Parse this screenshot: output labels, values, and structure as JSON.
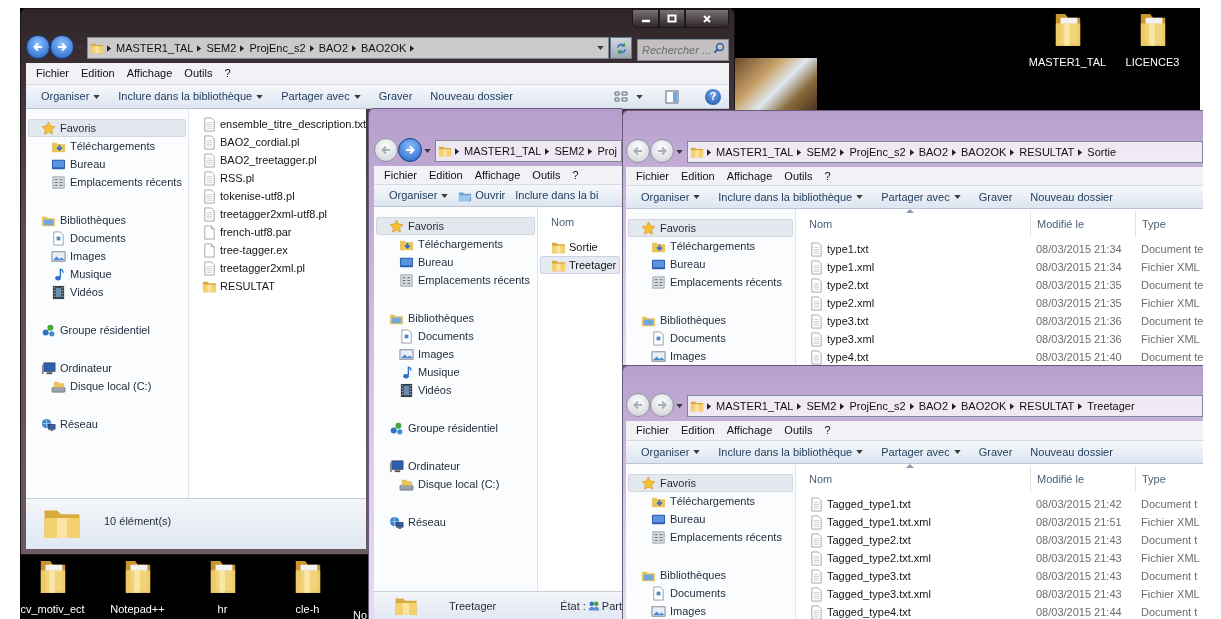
{
  "desktop": {
    "top_icons": [
      {
        "label": "MASTER1_TAL",
        "partial": false
      },
      {
        "label": "LICENCE3",
        "partial": false
      }
    ],
    "bottom_icons": [
      {
        "label": "cv_motiv_ect",
        "partial": false
      },
      {
        "label": "Notepad++",
        "partial": false
      },
      {
        "label": "hr",
        "partial": false
      },
      {
        "label": "cle-h",
        "partial": false
      },
      {
        "label": "No",
        "partial": true
      }
    ]
  },
  "windows": [
    {
      "title_buttons": true,
      "back_enabled": true,
      "forward_enabled": true,
      "address": {
        "crumbs": [
          "MASTER1_TAL",
          "SEM2",
          "ProjEnc_s2",
          "BAO2",
          "BAO2OK"
        ],
        "trailing_arrow": true,
        "refresh_button": true
      },
      "search": {
        "placeholder": "Rechercher ..."
      },
      "menu": [
        "Fichier",
        "Edition",
        "Affichage",
        "Outils",
        "?"
      ],
      "toolbar": [
        {
          "label": "Organiser",
          "kind": "dropdown"
        },
        {
          "label": "Inclure dans la bibliothèque",
          "kind": "dropdown"
        },
        {
          "label": "Partager avec",
          "kind": "dropdown"
        },
        {
          "label": "Graver",
          "kind": "button"
        },
        {
          "label": "Nouveau dossier",
          "kind": "button"
        }
      ],
      "view_buttons": [
        {
          "kind": "views"
        },
        {
          "kind": "preview"
        },
        {
          "kind": "help",
          "label": "?"
        }
      ],
      "sidebar": [
        {
          "label": "Favoris",
          "kind": "star",
          "selected": true,
          "children": [
            {
              "label": "Téléchargements",
              "kind": "download",
              "selected": false
            },
            {
              "label": "Bureau",
              "kind": "desktop",
              "selected": false
            },
            {
              "label": "Emplacements récents",
              "kind": "recent",
              "selected": false
            }
          ]
        },
        {
          "label": "Bibliothèques",
          "kind": "library",
          "selected": false,
          "children": [
            {
              "label": "Documents",
              "kind": "documents",
              "selected": false
            },
            {
              "label": "Images",
              "kind": "images",
              "selected": false
            },
            {
              "label": "Musique",
              "kind": "music",
              "selected": false
            },
            {
              "label": "Vidéos",
              "kind": "videos",
              "selected": false
            }
          ]
        },
        {
          "label": "Groupe résidentiel",
          "kind": "homegroup",
          "selected": false
        },
        {
          "label": "Ordinateur",
          "kind": "computer",
          "selected": false,
          "children": [
            {
              "label": "Disque local (C:)",
              "kind": "disk",
              "selected": false
            }
          ]
        },
        {
          "label": "Réseau",
          "kind": "network",
          "selected": false
        }
      ],
      "files": [
        {
          "name": "ensemble_titre_description.txt",
          "kind": "text",
          "selected": false
        },
        {
          "name": "BAO2_cordial.pl",
          "kind": "text",
          "selected": false
        },
        {
          "name": "BAO2_treetagger.pl",
          "kind": "text",
          "selected": false
        },
        {
          "name": "RSS.pl",
          "kind": "text",
          "selected": false
        },
        {
          "name": "tokenise-utf8.pl",
          "kind": "text",
          "selected": false
        },
        {
          "name": "treetagger2xml-utf8.pl",
          "kind": "text",
          "selected": false
        },
        {
          "name": "french-utf8.par",
          "kind": "blank",
          "selected": false
        },
        {
          "name": "tree-tagger.ex",
          "kind": "blank",
          "selected": false
        },
        {
          "name": "treetagger2xml.pl",
          "kind": "text",
          "selected": false
        },
        {
          "name": "RESULTAT",
          "kind": "folder",
          "selected": false
        }
      ],
      "status": {
        "kind": "count",
        "text": "10 élément(s)"
      }
    },
    {
      "back_enabled": false,
      "forward_enabled": true,
      "address": {
        "crumbs": [
          "MASTER1_TAL",
          "SEM2",
          "Proj"
        ],
        "trailing_arrow": false,
        "refresh_button": false
      },
      "menu": [
        "Fichier",
        "Edition",
        "Affichage",
        "Outils",
        "?"
      ],
      "toolbar": [
        {
          "label": "Organiser",
          "kind": "dropdown"
        },
        {
          "label": "Ouvrir",
          "kind": "open"
        },
        {
          "label": "Inclure dans la bi",
          "kind": "button"
        }
      ],
      "sidebar": [
        {
          "label": "Favoris",
          "kind": "star",
          "selected": true,
          "children": [
            {
              "label": "Téléchargements",
              "kind": "download",
              "selected": false
            },
            {
              "label": "Bureau",
              "kind": "desktop",
              "selected": false
            },
            {
              "label": "Emplacements récents",
              "kind": "recent",
              "selected": false
            }
          ]
        },
        {
          "label": "Bibliothèques",
          "kind": "library",
          "selected": false,
          "children": [
            {
              "label": "Documents",
              "kind": "documents",
              "selected": false
            },
            {
              "label": "Images",
              "kind": "images",
              "selected": false
            },
            {
              "label": "Musique",
              "kind": "music",
              "selected": false
            },
            {
              "label": "Vidéos",
              "kind": "videos",
              "selected": false
            }
          ]
        },
        {
          "label": "Groupe résidentiel",
          "kind": "homegroup",
          "selected": false
        },
        {
          "label": "Ordinateur",
          "kind": "computer",
          "selected": false,
          "children": [
            {
              "label": "Disque local (C:)",
              "kind": "disk",
              "selected": false
            }
          ]
        },
        {
          "label": "Réseau",
          "kind": "network",
          "selected": false
        }
      ],
      "columns": [
        {
          "label": "Nom",
          "sorted": false
        }
      ],
      "files": [
        {
          "name": "Sortie",
          "kind": "folder",
          "selected": false
        },
        {
          "name": "Treetager",
          "kind": "folder",
          "selected": true
        }
      ],
      "status": {
        "kind": "item",
        "name": "Treetager",
        "state_label": "État :",
        "state_value": "Part"
      }
    },
    {
      "back_enabled": false,
      "forward_enabled": false,
      "address": {
        "crumbs": [
          "MASTER1_TAL",
          "SEM2",
          "ProjEnc_s2",
          "BAO2",
          "BAO2OK",
          "RESULTAT",
          "Sortie"
        ],
        "trailing_arrow": false,
        "refresh_button": false
      },
      "menu": [
        "Fichier",
        "Edition",
        "Affichage",
        "Outils",
        "?"
      ],
      "toolbar": [
        {
          "label": "Organiser",
          "kind": "dropdown"
        },
        {
          "label": "Inclure dans la bibliothèque",
          "kind": "dropdown"
        },
        {
          "label": "Partager avec",
          "kind": "dropdown"
        },
        {
          "label": "Graver",
          "kind": "button"
        },
        {
          "label": "Nouveau dossier",
          "kind": "button"
        }
      ],
      "sidebar": [
        {
          "label": "Favoris",
          "kind": "star",
          "selected": true,
          "children": [
            {
              "label": "Téléchargements",
              "kind": "download",
              "selected": false
            },
            {
              "label": "Bureau",
              "kind": "desktop",
              "selected": false
            },
            {
              "label": "Emplacements récents",
              "kind": "recent",
              "selected": false
            }
          ]
        },
        {
          "label": "Bibliothèques",
          "kind": "library",
          "selected": false,
          "children": [
            {
              "label": "Documents",
              "kind": "documents",
              "selected": false
            },
            {
              "label": "Images",
              "kind": "images",
              "selected": false
            }
          ]
        }
      ],
      "columns": [
        {
          "label": "Nom",
          "sorted": true
        },
        {
          "label": "Modifié le",
          "sorted": false
        },
        {
          "label": "Type",
          "sorted": false
        }
      ],
      "files": [
        {
          "name": "type1.txt",
          "modified": "08/03/2015 21:34",
          "type": "Document te",
          "kind": "text",
          "selected": false
        },
        {
          "name": "type1.xml",
          "modified": "08/03/2015 21:34",
          "type": "Fichier XML",
          "kind": "text",
          "selected": false
        },
        {
          "name": "type2.txt",
          "modified": "08/03/2015 21:35",
          "type": "Document te",
          "kind": "text",
          "selected": false
        },
        {
          "name": "type2.xml",
          "modified": "08/03/2015 21:35",
          "type": "Fichier XML",
          "kind": "text",
          "selected": false
        },
        {
          "name": "type3.txt",
          "modified": "08/03/2015 21:36",
          "type": "Document te",
          "kind": "text",
          "selected": false
        },
        {
          "name": "type3.xml",
          "modified": "08/03/2015 21:36",
          "type": "Fichier XML",
          "kind": "text",
          "selected": false
        },
        {
          "name": "type4.txt",
          "modified": "08/03/2015 21:40",
          "type": "Document te",
          "kind": "text",
          "selected": false
        }
      ]
    },
    {
      "back_enabled": false,
      "forward_enabled": false,
      "address": {
        "crumbs": [
          "MASTER1_TAL",
          "SEM2",
          "ProjEnc_s2",
          "BAO2",
          "BAO2OK",
          "RESULTAT",
          "Treetager"
        ],
        "trailing_arrow": false,
        "refresh_button": false
      },
      "menu": [
        "Fichier",
        "Edition",
        "Affichage",
        "Outils",
        "?"
      ],
      "toolbar": [
        {
          "label": "Organiser",
          "kind": "dropdown"
        },
        {
          "label": "Inclure dans la bibliothèque",
          "kind": "dropdown"
        },
        {
          "label": "Partager avec",
          "kind": "dropdown"
        },
        {
          "label": "Graver",
          "kind": "button"
        },
        {
          "label": "Nouveau dossier",
          "kind": "button"
        }
      ],
      "sidebar": [
        {
          "label": "Favoris",
          "kind": "star",
          "selected": true,
          "children": [
            {
              "label": "Téléchargements",
              "kind": "download",
              "selected": false
            },
            {
              "label": "Bureau",
              "kind": "desktop",
              "selected": false
            },
            {
              "label": "Emplacements récents",
              "kind": "recent",
              "selected": false
            }
          ]
        },
        {
          "label": "Bibliothèques",
          "kind": "library",
          "selected": false,
          "children": [
            {
              "label": "Documents",
              "kind": "documents",
              "selected": false
            },
            {
              "label": "Images",
              "kind": "images",
              "selected": false
            }
          ]
        }
      ],
      "columns": [
        {
          "label": "Nom",
          "sorted": true
        },
        {
          "label": "Modifié le",
          "sorted": false
        },
        {
          "label": "Type",
          "sorted": false
        }
      ],
      "files": [
        {
          "name": "Tagged_type1.txt",
          "modified": "08/03/2015 21:42",
          "type": "Document t",
          "kind": "text",
          "selected": false
        },
        {
          "name": "Tagged_type1.txt.xml",
          "modified": "08/03/2015 21:51",
          "type": "Fichier XML",
          "kind": "text",
          "selected": false
        },
        {
          "name": "Tagged_type2.txt",
          "modified": "08/03/2015 21:43",
          "type": "Document t",
          "kind": "text",
          "selected": false
        },
        {
          "name": "Tagged_type2.txt.xml",
          "modified": "08/03/2015 21:43",
          "type": "Fichier XML",
          "kind": "text",
          "selected": false
        },
        {
          "name": "Tagged_type3.txt",
          "modified": "08/03/2015 21:43",
          "type": "Document t",
          "kind": "text",
          "selected": false
        },
        {
          "name": "Tagged_type3.txt.xml",
          "modified": "08/03/2015 21:43",
          "type": "Fichier XML",
          "kind": "text",
          "selected": false
        },
        {
          "name": "Tagged_type4.txt",
          "modified": "08/03/2015 21:44",
          "type": "Document t",
          "kind": "text",
          "selected": false
        }
      ]
    }
  ]
}
